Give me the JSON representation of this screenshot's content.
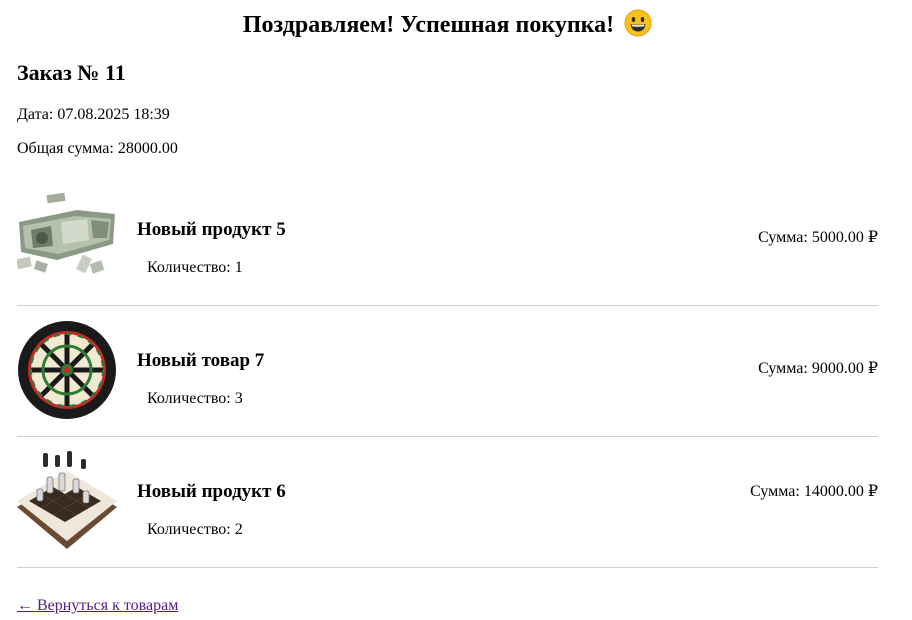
{
  "headline": {
    "text": "Поздравляем! Успешная покупка!",
    "emoji": "grinning-face"
  },
  "order": {
    "title": "Заказ № 11",
    "date": "Дата: 07.08.2025 18:39",
    "total": "Общая сумма: 28000.00"
  },
  "items": [
    {
      "name": "Новый продукт 5",
      "quantity": "Количество: 1",
      "sum": "Сумма: 5000.00 ₽",
      "image": "money-puzzle-image"
    },
    {
      "name": "Новый товар 7",
      "quantity": "Количество: 3",
      "sum": "Сумма: 9000.00 ₽",
      "image": "dartboard-image"
    },
    {
      "name": "Новый продукт 6",
      "quantity": "Количество: 2",
      "sum": "Сумма: 14000.00 ₽",
      "image": "chess-board-image"
    }
  ],
  "back_link": "← Вернуться к товарам",
  "colors": {
    "link_visited": "#551a8b",
    "divider": "#d0d0d0"
  }
}
